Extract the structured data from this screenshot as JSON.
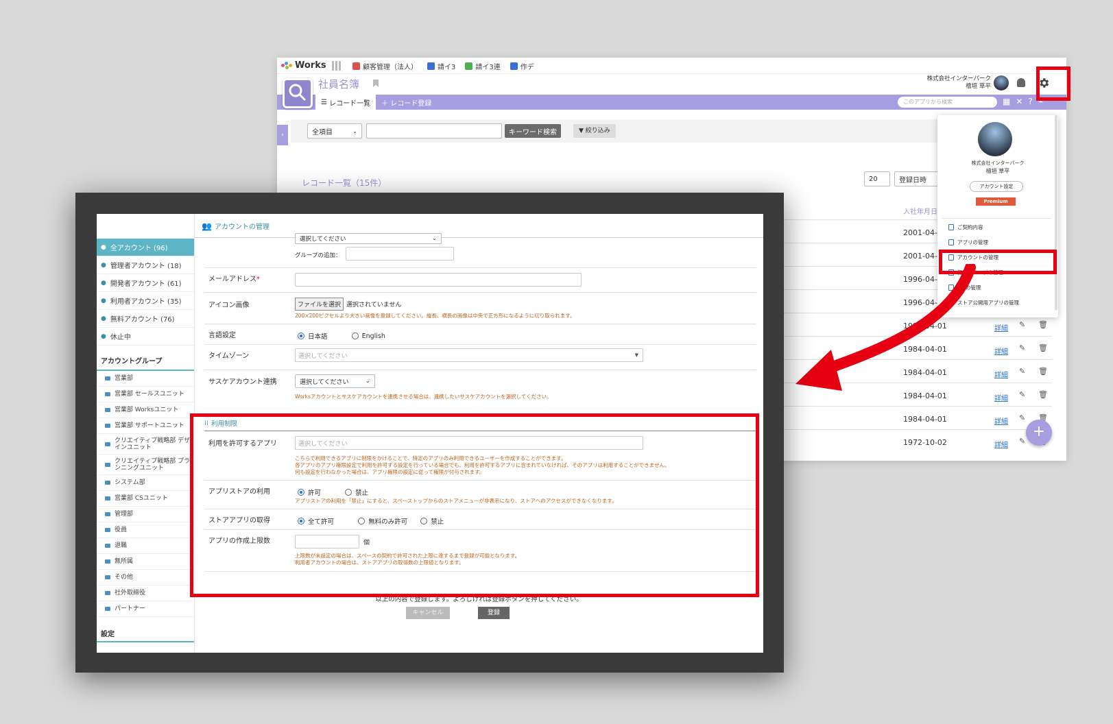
{
  "back_window": {
    "logo": "Works",
    "app_tabs": [
      {
        "label": "顧客管理（法人）",
        "color": "#d9534f"
      },
      {
        "label": "請イ3",
        "color": "#3b6fd4"
      },
      {
        "label": "請イ3連",
        "color": "#4caf50"
      },
      {
        "label": "作デ",
        "color": "#3b6fd4"
      }
    ],
    "app_title": "社員名簿",
    "user_company": "株式会社インターパーク",
    "user_name": "檜垣 草平",
    "tab_list": "レコード一覧",
    "tab_register": "レコード登録",
    "search_placeholder": "このアプリから検索",
    "filter_select": "全項目",
    "keyword_search": "キーワード検索",
    "narrow_down": "絞り込み",
    "records_title": "レコード一覧（15件）",
    "page_size": "20",
    "sort_field": "登録日時",
    "column_hire_date": "入社年月日",
    "rows": [
      {
        "date": "2001-04-0",
        "detail": ""
      },
      {
        "date": "2001-04-0",
        "detail": ""
      },
      {
        "date": "1996-04-0",
        "detail": ""
      },
      {
        "date": "1996-04-0",
        "detail": ""
      },
      {
        "date": "1984-04-01",
        "detail": "詳細"
      },
      {
        "date": "1984-04-01",
        "detail": "詳細"
      },
      {
        "date": "1984-04-01",
        "detail": "詳細"
      },
      {
        "date": "1984-04-01",
        "detail": "詳細"
      },
      {
        "date": "1984-04-01",
        "detail": "詳細"
      },
      {
        "date": "1972-10-02",
        "detail": "詳細"
      }
    ],
    "fab": "+"
  },
  "dropdown": {
    "company": "株式会社インターパーク",
    "name": "檜垣 草平",
    "account_settings": "アカウント設定",
    "premium": "Premium",
    "items": [
      {
        "label": "ご契約内容",
        "icon": "document-icon"
      },
      {
        "label": "アプリの管理",
        "icon": "app-icon"
      },
      {
        "label": "アカウントの管理",
        "icon": "users-gear-icon"
      },
      {
        "label": "権限グループの管理",
        "icon": "group-icon"
      },
      {
        "label": "APIの管理",
        "icon": "braces-icon"
      },
      {
        "label": "ストア公開用アプリの管理",
        "icon": "store-icon"
      }
    ]
  },
  "front_window": {
    "page_title": "アカウントの管理",
    "sidebar": {
      "accounts": [
        {
          "label": "全アカウント (96)",
          "active": true
        },
        {
          "label": "管理者アカウント (18)",
          "active": false
        },
        {
          "label": "開発者アカウント (61)",
          "active": false
        },
        {
          "label": "利用者アカウント (35)",
          "active": false
        },
        {
          "label": "無料アカウント (76)",
          "active": false
        },
        {
          "label": "休止中",
          "active": false
        }
      ],
      "groups_header": "アカウントグループ",
      "groups": [
        "営業部",
        "営業部 セールスユニット",
        "営業部 Worksユニット",
        "営業部 サポートユニット",
        "クリエイティブ戦略部 デザインユニット",
        "クリエイティブ戦略部 プランニングユニット",
        "システム部",
        "営業部 CSユニット",
        "管理部",
        "役員",
        "退職",
        "無所属",
        "その他",
        "社外取締役",
        "パートナー"
      ],
      "settings_header": "設定"
    },
    "form": {
      "group_select_placeholder": "選択してください",
      "group_add_label": "グループの追加：",
      "email_label": "メールアドレス",
      "required_mark": "*",
      "icon_label": "アイコン画像",
      "file_button": "ファイルを選択",
      "file_status": "選択されていません",
      "icon_note": "200×200ピクセルより大きい画像を登録してください。縦長、横長の画像は中央で正方形になるように切り取られます。",
      "language_label": "言語設定",
      "language_options": [
        "日本語",
        "English"
      ],
      "timezone_label": "タイムゾーン",
      "timezone_placeholder": "選択してください",
      "saske_label": "サスケアカウント連携",
      "saske_select": "選択してください",
      "saske_note": "Worksアカウントとサスケアカウントを連携させる場合は、連携したいサスケアカウントを選択してください。",
      "usage_section": "利用制限",
      "allowed_apps_label": "利用を許可するアプリ",
      "allowed_apps_placeholder": "選択してください",
      "allowed_apps_note1": "こちらで利用できるアプリに制限をかけることで、特定のアプリのみ利用できるユーザーを作成することができます。",
      "allowed_apps_note2": "各アプリのアプリ権限設定で利用を許可する設定を行っている場合でも、利用を許可するアプリに含まれていなければ、そのアプリは利用することができません。",
      "allowed_apps_note3": "何も設定を行わなかった場合は、アプリ権限の設定に従って権限が付与されます。",
      "appstore_label": "アプリストアの利用",
      "appstore_options": [
        "許可",
        "禁止"
      ],
      "appstore_note": "アプリストアの利用を「禁止」にすると、スペーストップからのストアメニューが非表示になり、ストアへのアクセスができなくなります。",
      "store_app_label": "ストアアプリの取得",
      "store_app_options": [
        "全て許可",
        "無料のみ許可",
        "禁止"
      ],
      "app_limit_label": "アプリの作成上限数",
      "app_limit_unit": "個",
      "app_limit_note1": "上限数が未設定の場合は、スペースの契約で許可された上限に達するまで登録が可能となります。",
      "app_limit_note2": "利用者アカウントの場合は、ストアアプリの取得数の上限値となります。",
      "confirm_text": "以上の内容で登録します。よろしければ登録ボタンを押してください。",
      "cancel_button": "キャンセル",
      "register_button": "登録"
    }
  },
  "colors": {
    "highlight_red": "#e60012",
    "purple": "#a79ee0",
    "teal": "#5db5c6"
  }
}
